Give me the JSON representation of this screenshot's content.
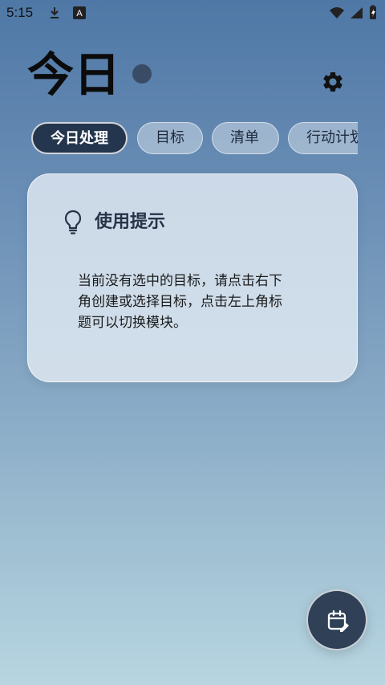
{
  "status_bar": {
    "time": "5:15",
    "icons": [
      "download-icon",
      "a-icon",
      "wifi-icon",
      "signal-icon",
      "battery-icon"
    ]
  },
  "header": {
    "title": "今日",
    "settings_icon": "gear-icon"
  },
  "tabs": [
    {
      "label": "今日处理",
      "active": true
    },
    {
      "label": "目标",
      "active": false
    },
    {
      "label": "清单",
      "active": false
    },
    {
      "label": "行动计划",
      "active": false
    }
  ],
  "hint_card": {
    "icon": "lightbulb-icon",
    "title": "使用提示",
    "lines": [
      "当前没有选中的目标，请点击右下",
      "角创建或选择目标，点击左上角标",
      "题可以切换模块。"
    ]
  },
  "fab": {
    "icon": "calendar-edit-icon"
  },
  "colors": {
    "accent": "#24364d",
    "card_bg": "#e2eaf3",
    "title_dot": "#3a4b66"
  }
}
